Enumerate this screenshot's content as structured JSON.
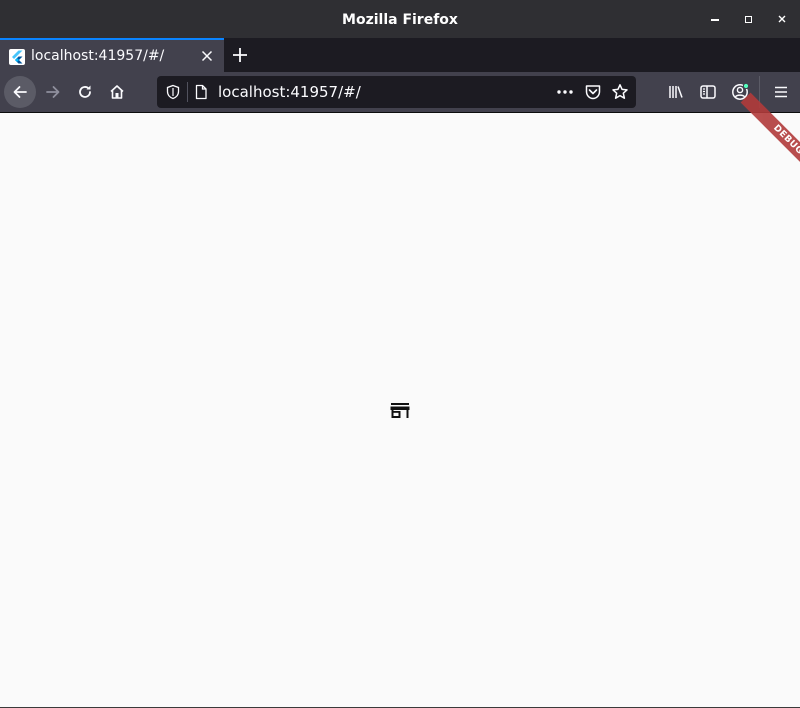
{
  "window": {
    "title": "Mozilla Firefox"
  },
  "tabs": [
    {
      "title": "localhost:41957/#/",
      "favicon": "flutter-icon",
      "active": true
    }
  ],
  "toolbar": {
    "url": "localhost:41957/#/",
    "icons": [
      "back-arrow-icon",
      "forward-arrow-icon",
      "reload-icon",
      "home-icon",
      "shield-icon",
      "page-icon",
      "more-dots-icon",
      "pocket-icon",
      "star-icon",
      "library-icon",
      "sidebar-icon",
      "account-icon",
      "hamburger-menu-icon"
    ]
  },
  "content": {
    "debug_banner": "DEBUG",
    "center_icon": "store-icon",
    "background": "#fafafa"
  },
  "colors": {
    "tab_accent": "#0a84ff",
    "debug_banner": "#b13b3b",
    "toolbar": "#42414d",
    "titlebar": "#2f2f33"
  }
}
